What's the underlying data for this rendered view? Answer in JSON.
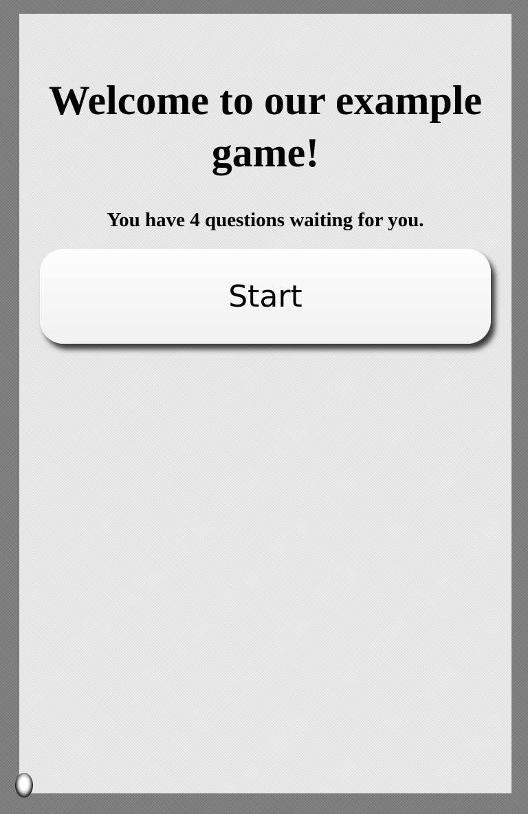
{
  "welcome": {
    "title": "Welcome to our example game!",
    "subtitle": "You have 4 questions waiting for you.",
    "question_count": 4
  },
  "actions": {
    "start_label": "Start"
  },
  "colors": {
    "page_background": "#7d7d7d",
    "panel_background": "#e6e6e6",
    "button_background": "#f7f7f7",
    "text": "#000000"
  }
}
